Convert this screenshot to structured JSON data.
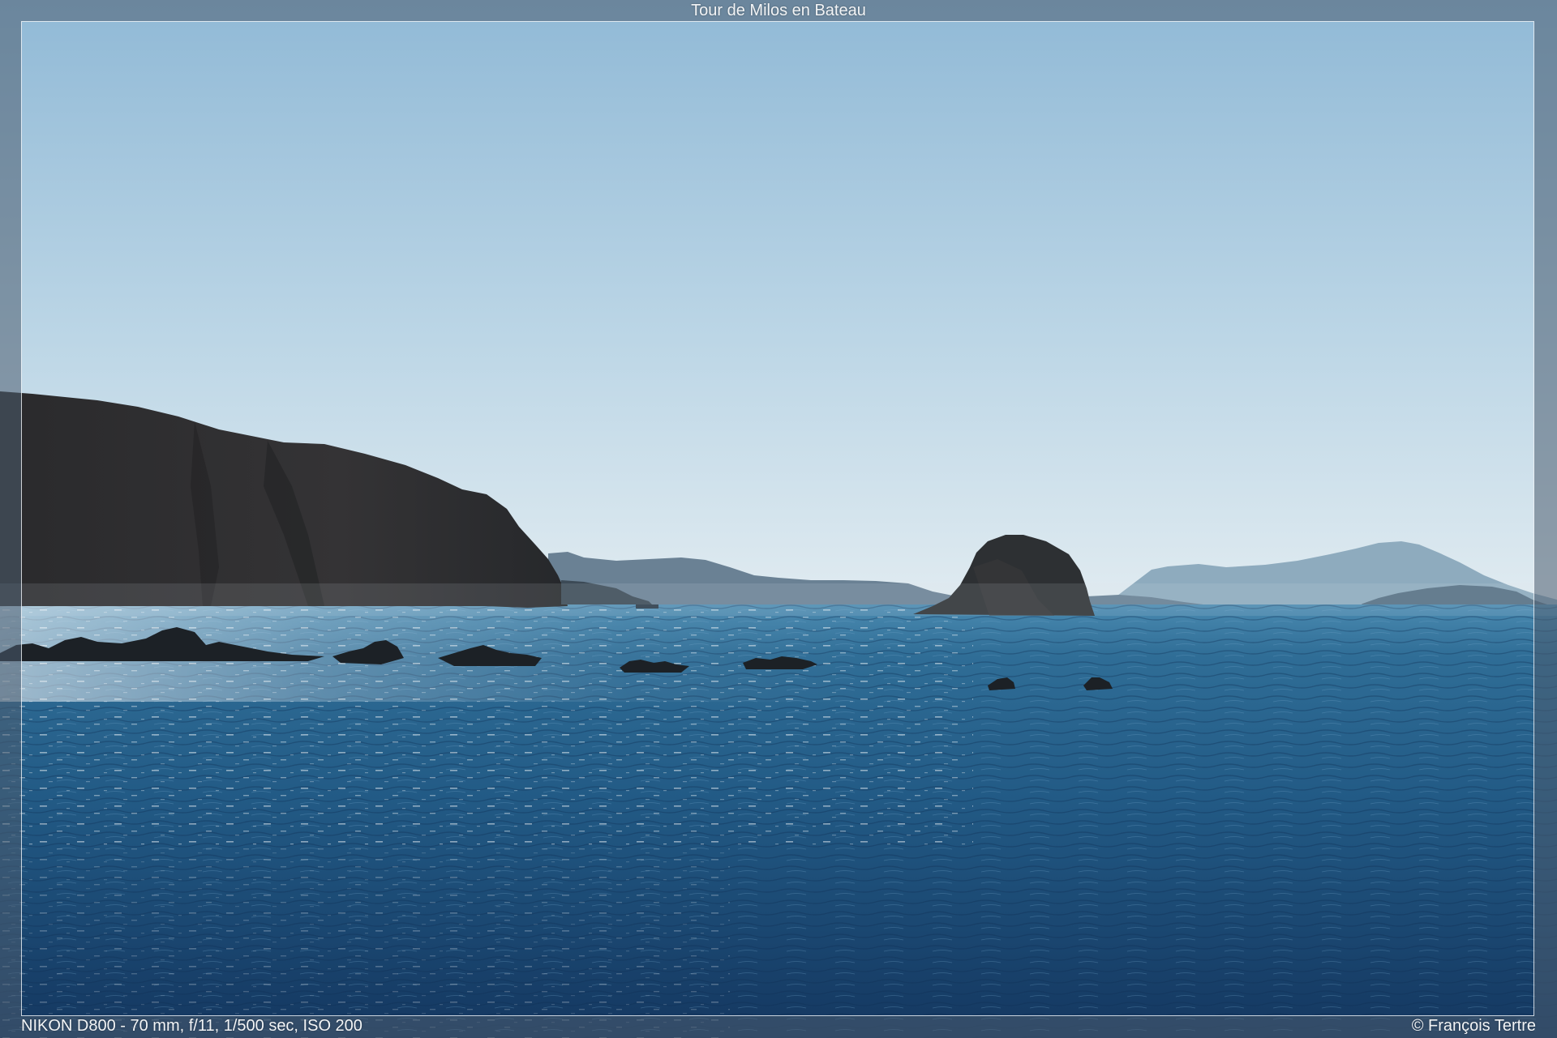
{
  "header": {
    "title": "Tour de Milos en Bateau"
  },
  "footer": {
    "exif": "NIKON D800 - 70 mm, f/11, 1/500 sec, ISO 200",
    "copyright": "© François Tertre"
  },
  "colors": {
    "sky_top": "#8fb9d6",
    "sky_horizon": "#dfeaf0",
    "sea_horizon": "#3f7ea3",
    "sea_deep": "#163b60",
    "cliff": "#2c2c2e",
    "distant_hills": "#7f9bb0",
    "border_band": "#5a6b7c",
    "frame_line": "#eef2f5"
  }
}
